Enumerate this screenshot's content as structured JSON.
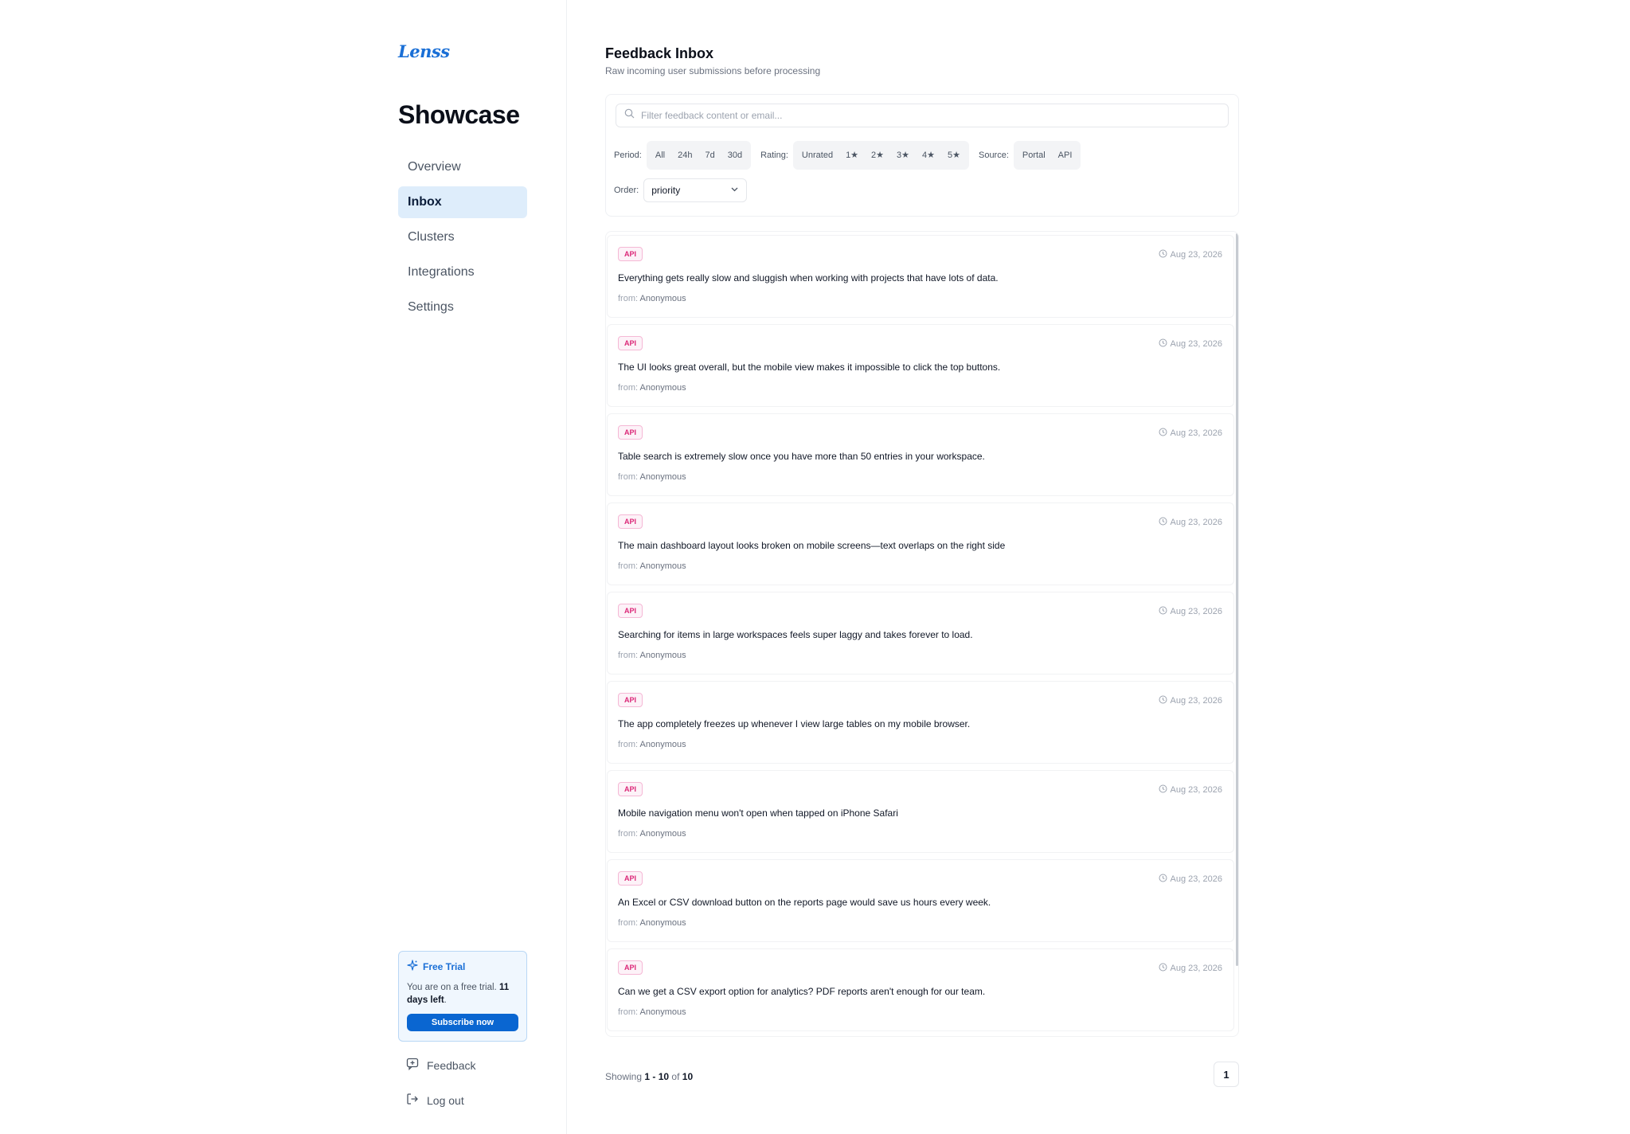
{
  "brand": {
    "logo_text": "Lenss",
    "workspace": "Showcase"
  },
  "nav": {
    "items": [
      {
        "label": "Overview",
        "active": false
      },
      {
        "label": "Inbox",
        "active": true
      },
      {
        "label": "Clusters",
        "active": false
      },
      {
        "label": "Integrations",
        "active": false
      },
      {
        "label": "Settings",
        "active": false
      }
    ]
  },
  "trial": {
    "title": "Free Trial",
    "text_prefix": "You are on a free trial. ",
    "text_days": "11 days left",
    "text_suffix": ".",
    "button": "Subscribe now"
  },
  "footer_links": {
    "feedback": "Feedback",
    "logout": "Log out"
  },
  "header": {
    "title": "Feedback Inbox",
    "subtitle": "Raw incoming user submissions before processing"
  },
  "filters": {
    "search_placeholder": "Filter feedback content or email...",
    "period_label": "Period:",
    "period_options": [
      "All",
      "24h",
      "7d",
      "30d"
    ],
    "rating_label": "Rating:",
    "rating_options": [
      "Unrated",
      "1★",
      "2★",
      "3★",
      "4★",
      "5★"
    ],
    "source_label": "Source:",
    "source_options": [
      "Portal",
      "API"
    ],
    "order_label": "Order:",
    "order_value": "priority"
  },
  "feedback": [
    {
      "source": "API",
      "date": "Aug 23, 2026",
      "content": "Everything gets really slow and sluggish when working with projects that have lots of data.",
      "from_label": "from:",
      "from": "Anonymous"
    },
    {
      "source": "API",
      "date": "Aug 23, 2026",
      "content": "The UI looks great overall, but the mobile view makes it impossible to click the top buttons.",
      "from_label": "from:",
      "from": "Anonymous"
    },
    {
      "source": "API",
      "date": "Aug 23, 2026",
      "content": "Table search is extremely slow once you have more than 50 entries in your workspace.",
      "from_label": "from:",
      "from": "Anonymous"
    },
    {
      "source": "API",
      "date": "Aug 23, 2026",
      "content": "The main dashboard layout looks broken on mobile screens—text overlaps on the right side",
      "from_label": "from:",
      "from": "Anonymous"
    },
    {
      "source": "API",
      "date": "Aug 23, 2026",
      "content": "Searching for items in large workspaces feels super laggy and takes forever to load.",
      "from_label": "from:",
      "from": "Anonymous"
    },
    {
      "source": "API",
      "date": "Aug 23, 2026",
      "content": "The app completely freezes up whenever I view large tables on my mobile browser.",
      "from_label": "from:",
      "from": "Anonymous"
    },
    {
      "source": "API",
      "date": "Aug 23, 2026",
      "content": "Mobile navigation menu won't open when tapped on iPhone Safari",
      "from_label": "from:",
      "from": "Anonymous"
    },
    {
      "source": "API",
      "date": "Aug 23, 2026",
      "content": "An Excel or CSV download button on the reports page would save us hours every week.",
      "from_label": "from:",
      "from": "Anonymous"
    },
    {
      "source": "API",
      "date": "Aug 23, 2026",
      "content": "Can we get a CSV export option for analytics? PDF reports aren't enough for our team.",
      "from_label": "from:",
      "from": "Anonymous"
    }
  ],
  "pagination": {
    "showing_label": "Showing",
    "range": "1 - 10",
    "of_label": "of",
    "total": "10",
    "current_page": "1"
  },
  "colors": {
    "accent": "#0a66d1",
    "active_nav_bg": "#deedfb",
    "badge_pink": "#db2777"
  },
  "icons": {
    "search": "search-icon",
    "trial": "sparkle-icon",
    "date": "clock-icon",
    "feedback": "message-plus-icon",
    "logout": "logout-icon",
    "select": "chevron-down-icon"
  }
}
